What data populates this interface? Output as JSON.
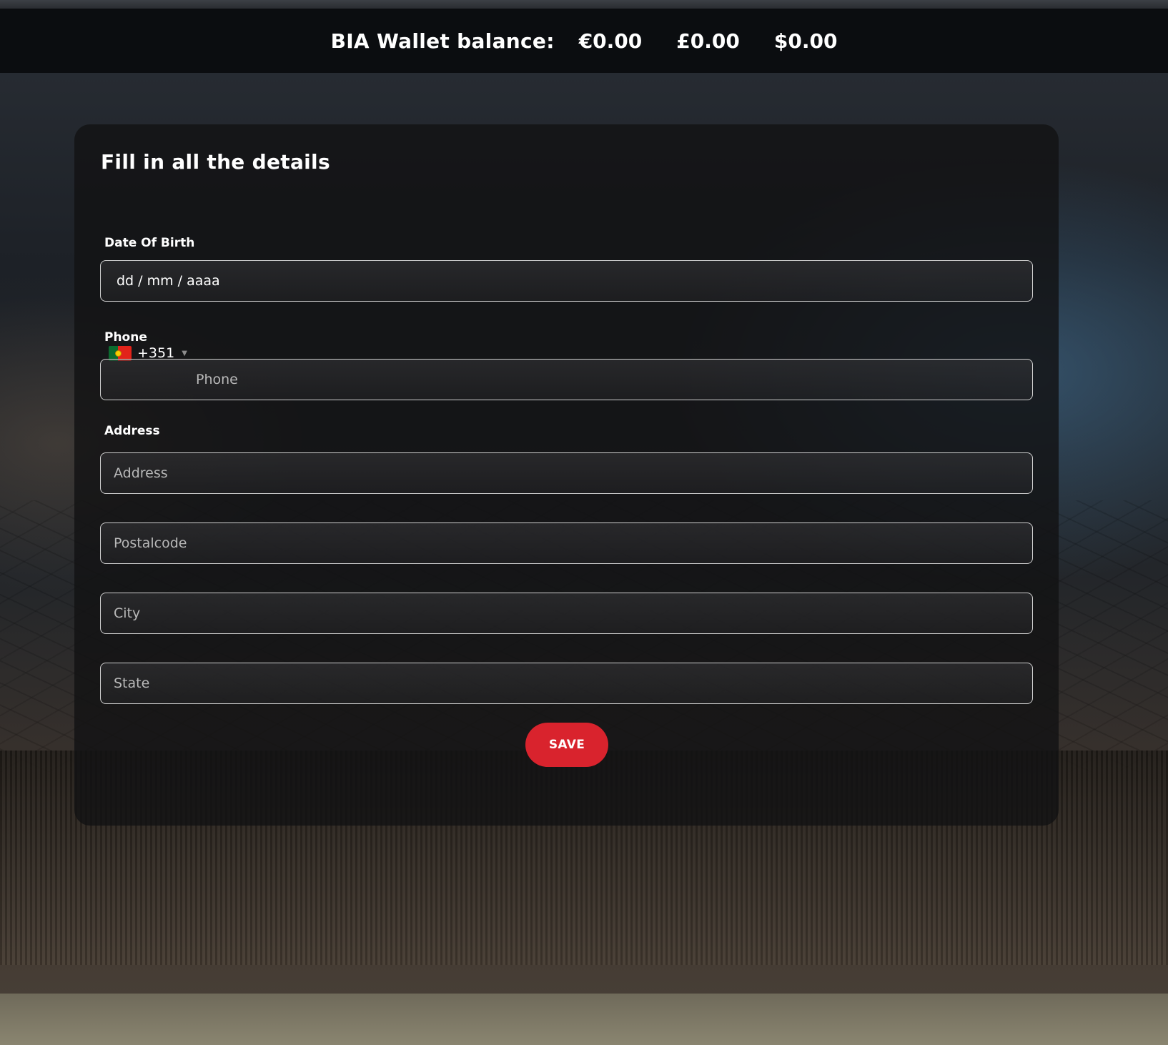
{
  "header": {
    "wallet_title": "BIA Wallet balance:",
    "balances": [
      "€0.00",
      "£0.00",
      "$0.00"
    ]
  },
  "form": {
    "title": "Fill in all the details",
    "dob": {
      "label": "Date Of Birth",
      "value": "dd / mm / aaaa"
    },
    "phone": {
      "label": "Phone",
      "country_code": "+351",
      "flag_icon": "portugal-flag-icon",
      "placeholder": "Phone"
    },
    "address": {
      "label": "Address",
      "placeholder": "Address"
    },
    "postalcode": {
      "placeholder": "Postalcode"
    },
    "city": {
      "placeholder": "City"
    },
    "state": {
      "placeholder": "State"
    },
    "save_label": "SAVE"
  },
  "colors": {
    "accent": "#d9232d",
    "bar_bg": "#0b0d10",
    "card_bg": "#121214"
  }
}
